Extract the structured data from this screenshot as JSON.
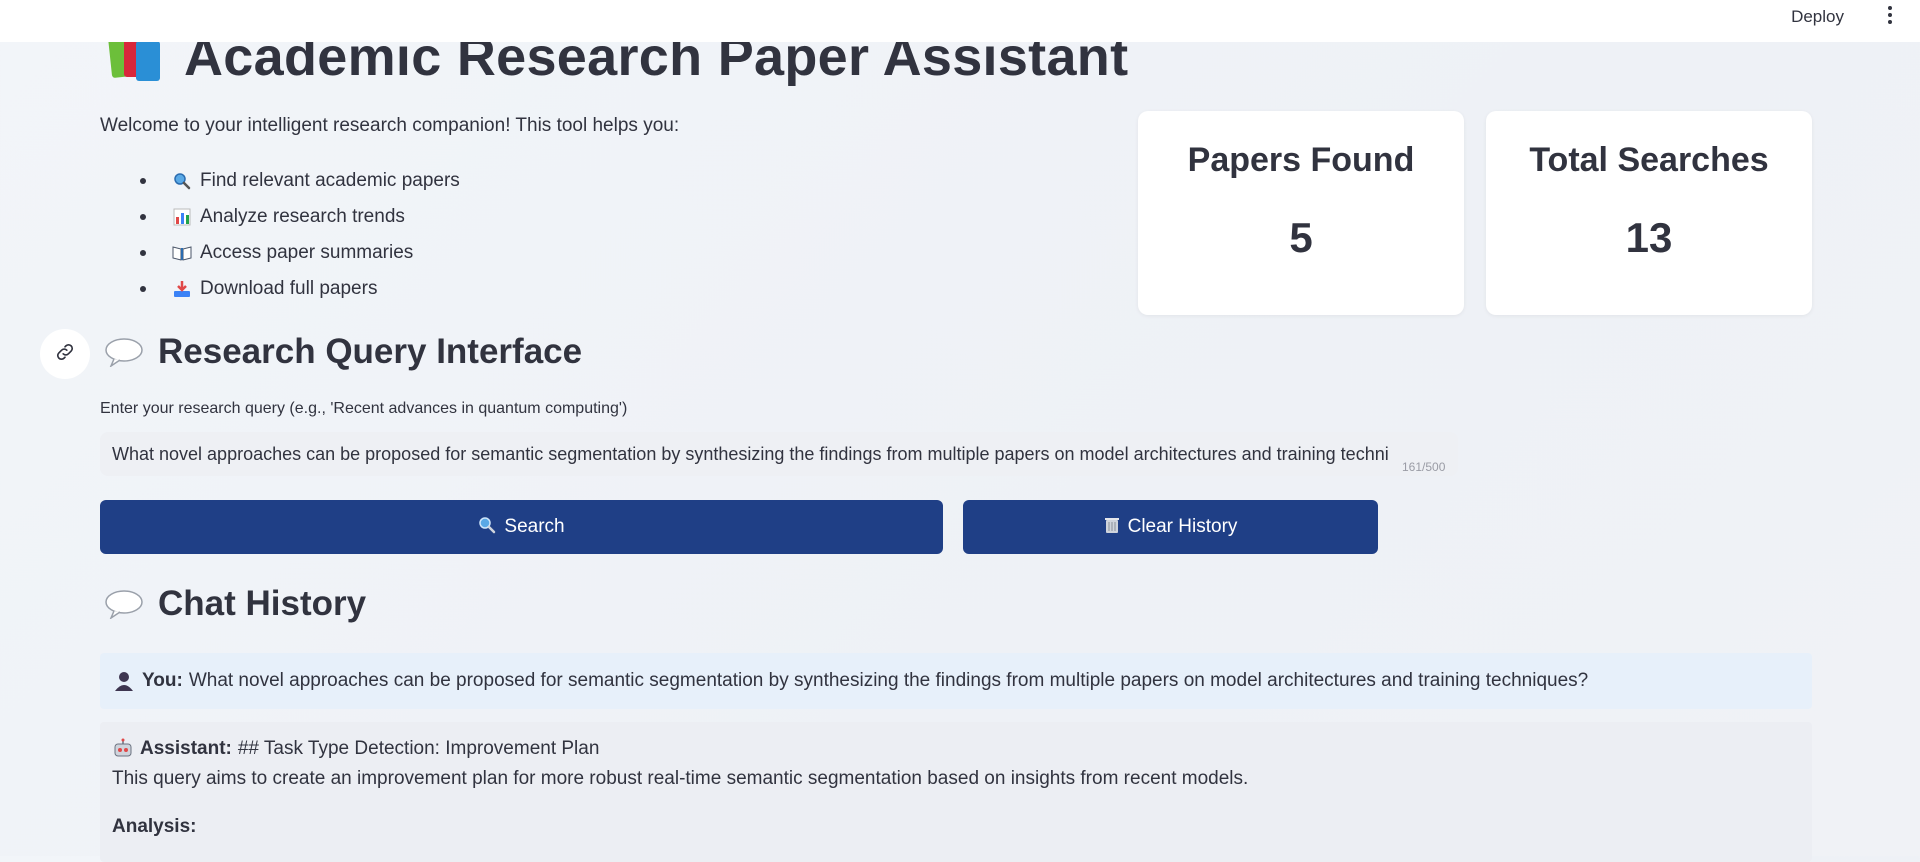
{
  "topbar": {
    "deploy_label": "Deploy"
  },
  "header": {
    "title": "Academic Research Paper Assistant"
  },
  "intro": {
    "welcome": "Welcome to your intelligent research companion! This tool helps you:",
    "features": [
      {
        "icon": "magnifier-icon",
        "label": "Find relevant academic papers"
      },
      {
        "icon": "bar-chart-icon",
        "label": "Analyze research trends"
      },
      {
        "icon": "open-book-icon",
        "label": "Access paper summaries"
      },
      {
        "icon": "download-icon",
        "label": "Download full papers"
      }
    ]
  },
  "metrics": {
    "papers_found": {
      "label": "Papers Found",
      "value": "5"
    },
    "total_searches": {
      "label": "Total Searches",
      "value": "13"
    }
  },
  "query_section": {
    "heading": "Research Query Interface",
    "input_label": "Enter your research query (e.g., 'Recent advances in quantum computing')",
    "input_value": "What novel approaches can be proposed for semantic segmentation by synthesizing the findings from multiple papers on model architectures and training techni",
    "char_count": "161/500"
  },
  "buttons": {
    "search_label": "Search",
    "clear_label": "Clear History"
  },
  "chat": {
    "heading": "Chat History",
    "user": {
      "speaker": "You:",
      "text": "What novel approaches can be proposed for semantic segmentation by synthesizing the findings from multiple papers on model architectures and training techniques?"
    },
    "assistant": {
      "speaker": "Assistant:",
      "line1": "## Task Type Detection: Improvement Plan",
      "line2": "This query aims to create an improvement plan for more robust real-time semantic segmentation based on insights from recent models.",
      "line3": "Analysis:"
    }
  },
  "colors": {
    "primary_button": "#1f3f86",
    "user_bubble": "#e7f0fa",
    "assistant_bubble": "#eceef3"
  }
}
